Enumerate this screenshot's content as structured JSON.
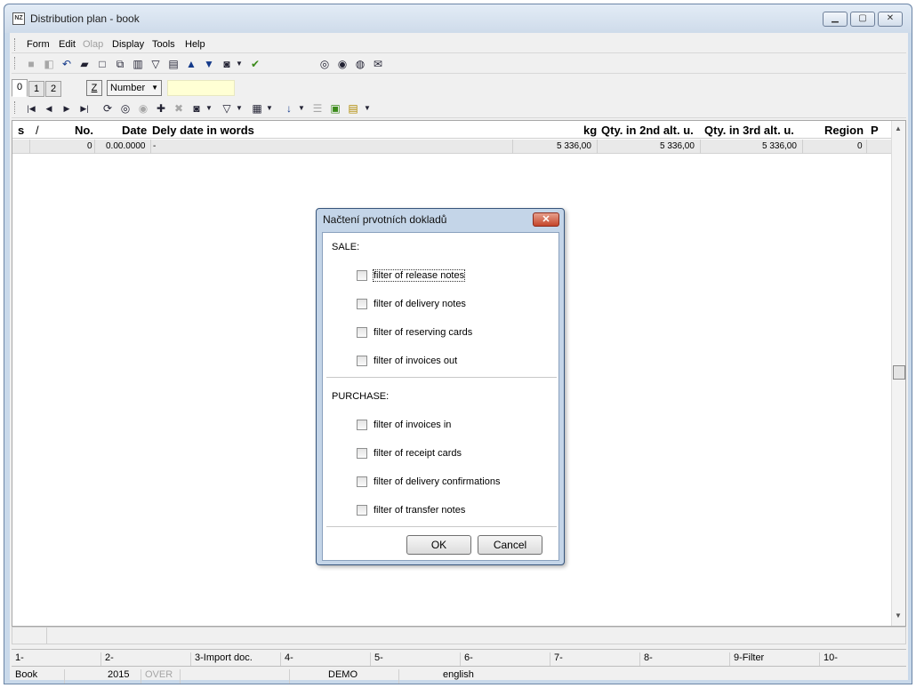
{
  "window": {
    "title": "Distribution plan - book",
    "app_icon": "NZ"
  },
  "menu": [
    "Form",
    "Edit",
    "Olap",
    "Display",
    "Tools",
    "Help"
  ],
  "tabs": [
    "0",
    "1",
    "2"
  ],
  "z_label": "Z",
  "sort_combo": "Number",
  "grid": {
    "headers": {
      "s": "s",
      "slash": "/",
      "no": "No.",
      "date": "Date",
      "dely": "Dely date in words",
      "kg": "kg",
      "qty2": "Qty. in 2nd alt. u.",
      "qty3": "Qty. in 3rd alt. u.",
      "region": "Region",
      "p": "P"
    },
    "row": {
      "no": "0",
      "date": "0.00.0000",
      "dely": "-",
      "kg": "5 336,00",
      "qty2": "5 336,00",
      "qty3": "5 336,00",
      "region": "0"
    }
  },
  "fkeys": [
    "1-",
    "2-",
    "3-Import doc.",
    "4-",
    "5-",
    "6-",
    "7-",
    "8-",
    "9-Filter",
    "10-"
  ],
  "status": {
    "book": "Book",
    "year": "2015",
    "over": "OVER",
    "demo": "DEMO",
    "lang": "english"
  },
  "dialog": {
    "title": "Načtení prvotních dokladů",
    "sale_label": "SALE:",
    "sale_items": [
      "filter of release notes",
      "filter of delivery notes",
      "filter of reserving cards",
      "filter of invoices out"
    ],
    "purchase_label": "PURCHASE:",
    "purchase_items": [
      "filter of invoices in",
      "filter of receipt cards",
      "filter of delivery confirmations",
      "filter of transfer notes"
    ],
    "ok": "OK",
    "cancel": "Cancel",
    "checked": [
      false,
      false,
      false,
      false,
      false,
      false,
      false,
      false
    ]
  }
}
